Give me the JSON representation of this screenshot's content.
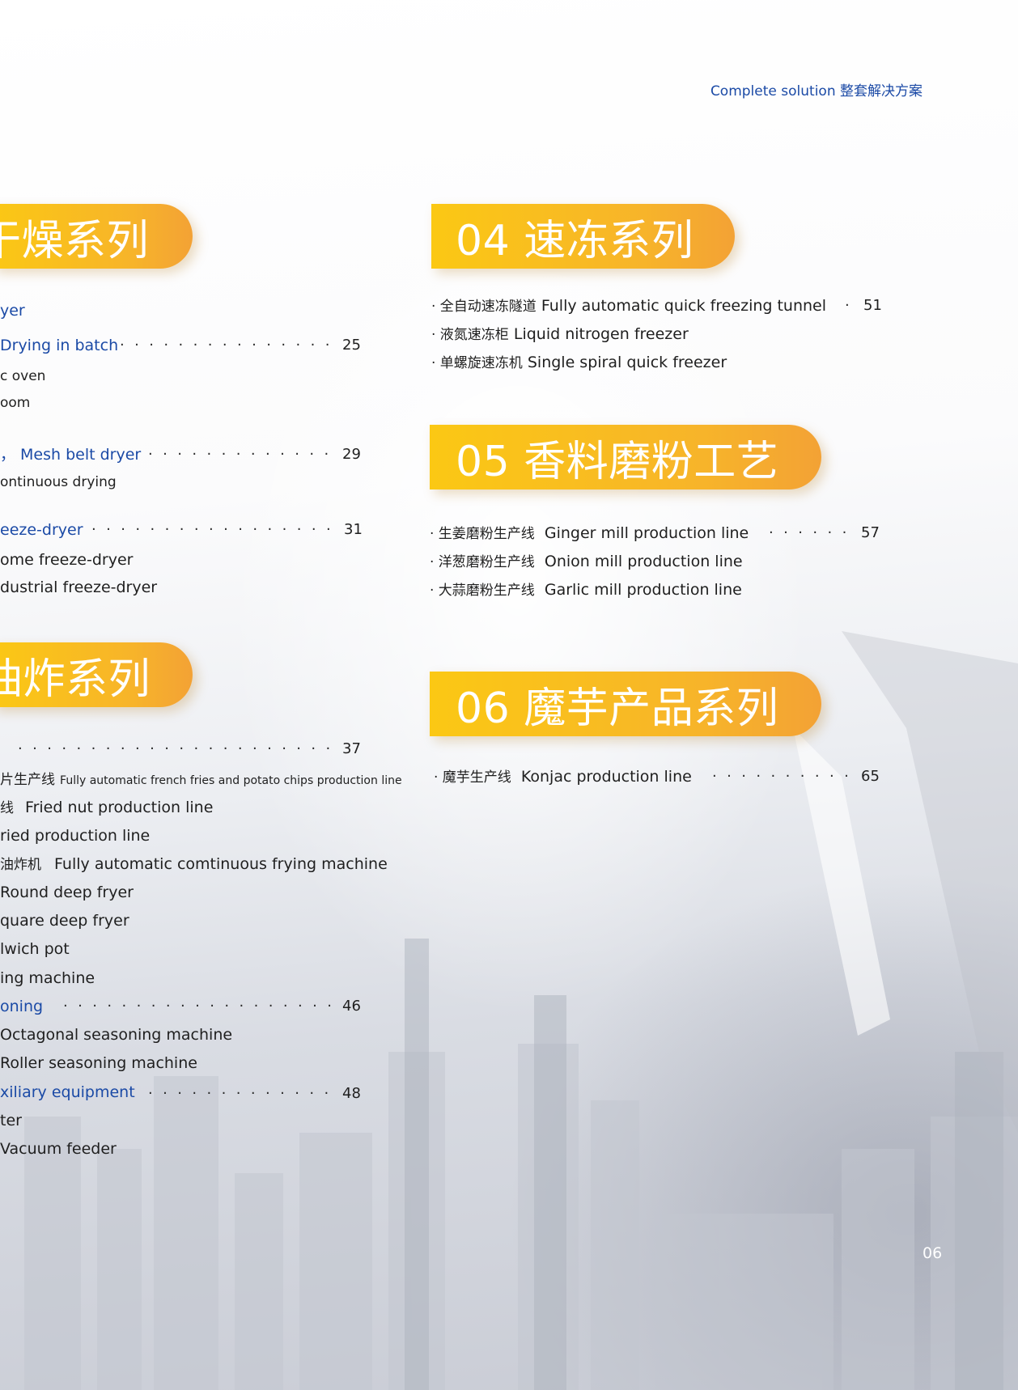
{
  "header": {
    "title": "Complete solution 整套解决方案"
  },
  "page_number": "06",
  "left_column": {
    "section_drying": {
      "banner": "干燥系列",
      "entries": [
        {
          "text": "yer"
        },
        {
          "text": "Drying in batch",
          "page": "25"
        },
        {
          "text": "c oven"
        },
        {
          "text": "oom"
        },
        {
          "text": "， Mesh belt dryer",
          "page": "29"
        },
        {
          "text": "ontinuous drying"
        },
        {
          "text": "eeze-dryer",
          "page": "31"
        },
        {
          "text": "ome freeze-dryer"
        },
        {
          "text": "dustrial freeze-dryer"
        }
      ]
    },
    "section_frying": {
      "banner": "油炸系列",
      "entries": [
        {
          "text": "",
          "page": "37"
        },
        {
          "zh": "片生产线",
          "en": "Fully automatic french fries and potato chips production line"
        },
        {
          "zh": "线",
          "en": "Fried nut production line"
        },
        {
          "text": "ried production line"
        },
        {
          "zh": "油炸机",
          "en": "Fully automatic comtinuous frying machine"
        },
        {
          "text": "Round deep fryer"
        },
        {
          "text": "quare deep fryer"
        },
        {
          "text": "lwich pot"
        },
        {
          "text": "ing machine"
        },
        {
          "text": "oning",
          "page": "46"
        },
        {
          "text": "Octagonal seasoning machine"
        },
        {
          "text": "Roller seasoning machine"
        },
        {
          "text": "xiliary equipment",
          "page": "48"
        },
        {
          "text": "ter"
        },
        {
          "text": "Vacuum feeder"
        }
      ]
    }
  },
  "right_column": {
    "section_04": {
      "banner": "04 速冻系列",
      "entries": [
        {
          "zh": "· 全自动速冻隧道",
          "en": "Fully automatic quick freezing tunnel",
          "page": "51"
        },
        {
          "zh": "· 液氮速冻柜",
          "en": "Liquid nitrogen freezer"
        },
        {
          "zh": "· 单螺旋速冻机",
          "en": "Single spiral quick freezer"
        }
      ]
    },
    "section_05": {
      "banner": "05 香料磨粉工艺",
      "entries": [
        {
          "zh": "· 生姜磨粉生产线",
          "en": "Ginger mill production line",
          "page": "57"
        },
        {
          "zh": "· 洋葱磨粉生产线",
          "en": "Onion mill production line"
        },
        {
          "zh": "· 大蒜磨粉生产线",
          "en": "Garlic mill production line"
        }
      ]
    },
    "section_06": {
      "banner": "06 魔芋产品系列",
      "entries": [
        {
          "zh": "· 魔芋生产线",
          "en": "Konjac production line",
          "page": "65"
        }
      ]
    }
  }
}
